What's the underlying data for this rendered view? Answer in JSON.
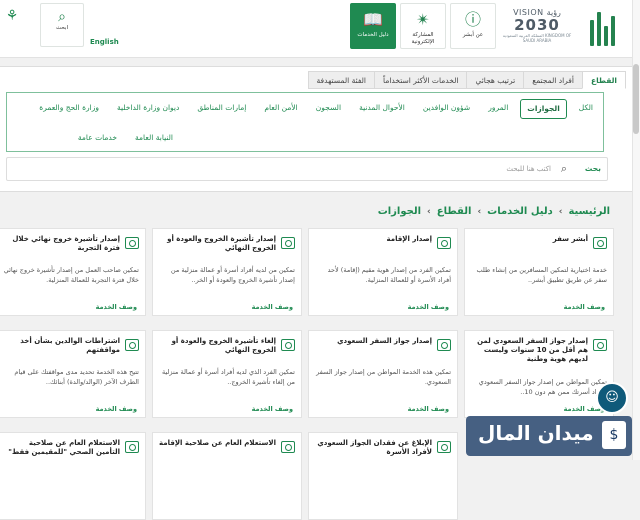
{
  "header": {
    "vision_top": "VISION رؤية",
    "vision_year": "2030",
    "vision_sub": "المملكة العربية السعودية KINGDOM OF SAUDI ARABIA",
    "buttons": [
      {
        "label": "عن أبشر",
        "icon": "info-icon"
      },
      {
        "label": "المشاركة الإلكترونية",
        "icon": "participation-icon"
      },
      {
        "label": "دليل الخدمات",
        "icon": "book-icon"
      }
    ],
    "search_label": "ابحث",
    "lang": "English"
  },
  "tabs": [
    "القطاع",
    "أفراد المجتمع",
    "ترتيب هجائي",
    "الخدمات الأكثر استخداماً",
    "الفئة المستهدفة"
  ],
  "filters": [
    "الكل",
    "الجوازات",
    "المرور",
    "شؤون الوافدين",
    "الأحوال المدنية",
    "السجون",
    "الأمن العام",
    "إمارات المناطق",
    "ديوان وزارة الداخلية",
    "وزارة الحج والعمرة",
    "النيابة العامة",
    "خدمات عامة"
  ],
  "search": {
    "label": "بحث",
    "placeholder": "اكتب هنا للبحث"
  },
  "breadcrumb": [
    "الرئيسية",
    "دليل الخدمات",
    "القطاع",
    "الجوازات"
  ],
  "cards": [
    {
      "title": "أبشر سفر",
      "desc": "خدمة اختيارية لتمكين المسافرين من إنشاء طلب سفر عن طريق تطبيق أبشر..",
      "link": "وصف الخدمة"
    },
    {
      "title": "إصدار الإقامة",
      "desc": "تمكين الفرد من إصدار هوية مقيم (إقامة) لأحد أفراد الأسرة أو للعمالة المنزلية.",
      "link": "وصف الخدمة"
    },
    {
      "title": "إصدار تأشيرة الخروج والعودة أو الخروج النهائي",
      "desc": "تمكين من لديه أفراد أسرة أو عمالة منزلية من إصدار تأشيرة الخروج والعودة أو الخر..",
      "link": "وصف الخدمة"
    },
    {
      "title": "إصدار تأشيرة خروج نهائي خلال فترة التجربة",
      "desc": "تمكين صاحب العمل من إصدار تأشيرة خروج نهائي خلال فترة التجربة للعمالة المنزلية.",
      "link": "وصف الخدمة"
    },
    {
      "title": "إصدار جواز السفر السعودي لمن هم أقل من 10 سنوات وليست لديهم هوية وطنية",
      "desc": "تمكين المواطن من إصدار جواز السفر السعودي لأفراد أسرتك ممن هم دون 10..",
      "link": "وصف الخدمة"
    },
    {
      "title": "إصدار جواز السفر السعودي",
      "desc": "تمكين هذه الخدمة المواطن من إصدار جواز السفر السعودي.",
      "link": "وصف الخدمة"
    },
    {
      "title": "إلغاء تأشيرة الخروج والعودة أو الخروج النهائي",
      "desc": "تمكين الفرد الذي لديه أفراد أسرة أو عمالة منزلية من إلغاء تأشيرة الخروج..",
      "link": "وصف الخدمة"
    },
    {
      "title": "اشتراطات الوالدين بشأن أخذ مواقفتهم",
      "desc": "تتيح هذه الخدمة تحديد مدى مواقفتك على قيام الطرف الآخر (الوالد/والدة) أبنائك..",
      "link": "وصف الخدمة"
    },
    {
      "title": "الإبلاغ عن فقدان الجواز السعودي لأفراد الأسرة",
      "desc": "",
      "link": ""
    },
    {
      "title": "الاستعلام العام عن صلاحية الإقامة",
      "desc": "",
      "link": ""
    },
    {
      "title": "الاستعلام العام عن صلاحية التأمين الصحي \"للمقيمين فقط\"",
      "desc": "",
      "link": ""
    }
  ],
  "watermark": "ميدان المال"
}
